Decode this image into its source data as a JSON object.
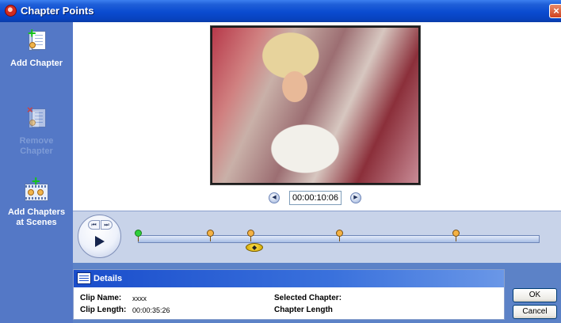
{
  "window": {
    "title": "Chapter Points"
  },
  "sidebar": {
    "items": [
      {
        "label_line1": "Add Chapter",
        "label_line2": "",
        "enabled": true,
        "icon": "add-chapter-icon"
      },
      {
        "label_line1": "Remove",
        "label_line2": "Chapter",
        "enabled": false,
        "icon": "remove-chapter-icon"
      },
      {
        "label_line1": "Add Chapters",
        "label_line2": "at Scenes",
        "enabled": true,
        "icon": "add-chapters-at-scenes-icon"
      }
    ]
  },
  "preview": {
    "timecode": "00:00:10:06",
    "prev_frame_icon": "step-back-icon",
    "next_frame_icon": "step-forward-icon"
  },
  "timeline": {
    "controls": {
      "back_glyph": "⏮",
      "forward_glyph": "⏭",
      "play_icon": "play-icon"
    },
    "start_marker_position": 0.0,
    "chapter_marker_positions": [
      0.18,
      0.28,
      0.5,
      0.79
    ],
    "scrubber_position": 0.29,
    "colors": {
      "start_marker": "#2fcf3a",
      "chapter_marker": "#f5b243",
      "scrubber": "#ffd21a"
    }
  },
  "details": {
    "title": "Details",
    "clip_name_label": "Clip Name:",
    "clip_name_value": "xxxx",
    "clip_length_label": "Clip Length:",
    "clip_length_value": "00:00:35:26",
    "selected_chapter_label": "Selected Chapter:",
    "chapter_length_label": "Chapter Length"
  },
  "buttons": {
    "ok": "OK",
    "cancel": "Cancel"
  },
  "colors": {
    "titlebar": "#0a4bd0",
    "sidebar": "#5478c6",
    "timeline_bg": "#c8d3e9",
    "details_header": "#1a4dcb"
  }
}
